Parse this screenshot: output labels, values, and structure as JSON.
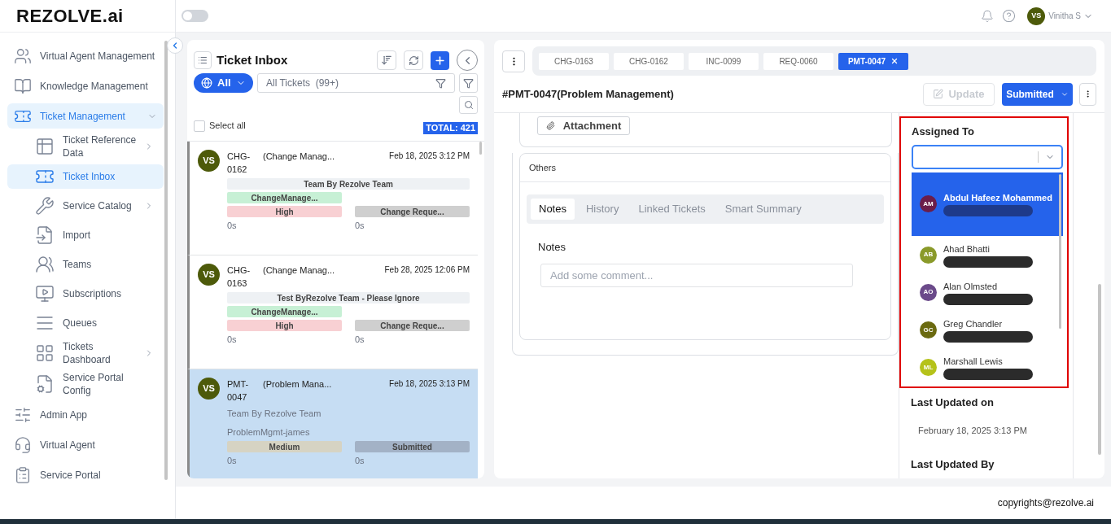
{
  "brand": {
    "name": "REZOLVE.ai"
  },
  "header": {
    "toggle": {
      "on": false
    },
    "user": {
      "initials": "VS",
      "name": "Vinitha S"
    }
  },
  "sidebar": {
    "items": [
      {
        "label": "Virtual Agent Management",
        "selected": false
      },
      {
        "label": "Knowledge Management",
        "selected": false
      },
      {
        "label": "Ticket Management",
        "selected": true,
        "expanded": true,
        "children": [
          {
            "label": "Ticket Reference Data",
            "selected": false,
            "submenu": true
          },
          {
            "label": "Ticket Inbox",
            "selected": true,
            "submenu": false
          },
          {
            "label": "Service Catalog",
            "selected": false,
            "submenu": true
          },
          {
            "label": "Import",
            "selected": false,
            "submenu": false
          },
          {
            "label": "Teams",
            "selected": false,
            "submenu": false
          },
          {
            "label": "Subscriptions",
            "selected": false,
            "submenu": false
          },
          {
            "label": "Queues",
            "selected": false,
            "submenu": false
          },
          {
            "label": "Tickets Dashboard",
            "selected": false,
            "submenu": true
          },
          {
            "label": "Service Portal Config",
            "selected": false,
            "submenu": false
          }
        ]
      },
      {
        "label": "Admin App",
        "selected": false
      },
      {
        "label": "Virtual Agent",
        "selected": false
      },
      {
        "label": "Service Portal",
        "selected": false
      }
    ]
  },
  "inbox": {
    "title": "Ticket Inbox",
    "scope": "All",
    "search": {
      "placeholder": "All Tickets  (99+)"
    },
    "select_all": {
      "label": "Select all",
      "checked": false
    },
    "total": "TOTAL: 421",
    "tickets": [
      {
        "initials": "VS",
        "id": "CHG-0162",
        "title": "(Change Manag...",
        "date": "Feb 18, 2025 3:12 PM",
        "team": "Team By Rezolve Team",
        "category": "ChangeManage...",
        "priority": {
          "label": "High",
          "color": "#f8d0d3"
        },
        "status": {
          "label": "Change Reque...",
          "color": "#cfcfcf"
        },
        "timer_1": "0s",
        "timer_2": "0s",
        "selected": false
      },
      {
        "initials": "VS",
        "id": "CHG-0163",
        "title": "(Change Manag...",
        "date": "Feb 28, 2025 12:06 PM",
        "team": "Test ByRezolve Team - Please Ignore",
        "category": "ChangeManage...",
        "priority": {
          "label": "High",
          "color": "#f8d0d3"
        },
        "status": {
          "label": "Change Reque...",
          "color": "#cfcfcf"
        },
        "timer_1": "0s",
        "timer_2": "0s",
        "selected": false
      },
      {
        "initials": "VS",
        "id": "PMT-0047",
        "title": "(Problem Mana...",
        "date": "Feb 18, 2025 3:13 PM",
        "team": "Team By Rezolve Team",
        "category": "ProblemMgmt-james",
        "priority": {
          "label": "Medium",
          "color": "#d6d3c3"
        },
        "status": {
          "label": "Submitted",
          "color": "#a3b2c6"
        },
        "timer_1": "0s",
        "timer_2": "0s",
        "selected": true
      }
    ]
  },
  "detail": {
    "tabs": [
      {
        "label": "CHG-0163",
        "selected": false
      },
      {
        "label": "CHG-0162",
        "selected": false
      },
      {
        "label": "INC-0099",
        "selected": false
      },
      {
        "label": "REQ-0060",
        "selected": false
      },
      {
        "label": "PMT-0047",
        "selected": true
      }
    ],
    "title": "#PMT-0047(Problem Management)",
    "update_button": {
      "label": "Update",
      "disabled": true
    },
    "status_button": "Submitted",
    "attachment_button": "Attachment",
    "others": {
      "title": "Others",
      "tabs": [
        {
          "label": "Notes",
          "selected": true
        },
        {
          "label": "History",
          "selected": false
        },
        {
          "label": "Linked Tickets",
          "selected": false
        },
        {
          "label": "Smart Summary",
          "selected": false
        }
      ],
      "notes_label": "Notes",
      "comment": {
        "placeholder": "Add some comment..."
      }
    },
    "assigned_to": {
      "label": "Assigned To",
      "options": [
        {
          "initials": "AM",
          "name": "Abdul Hafeez Mohammed",
          "color": "#6b1d4a",
          "selected": true
        },
        {
          "initials": "AB",
          "name": "Ahad Bhatti",
          "color": "#8a9a2a",
          "selected": false
        },
        {
          "initials": "AO",
          "name": "Alan Olmsted",
          "color": "#6b4a8a",
          "selected": false
        },
        {
          "initials": "GC",
          "name": "Greg Chandler",
          "color": "#6b6a10",
          "selected": false
        },
        {
          "initials": "ML",
          "name": "Marshall Lewis",
          "color": "#b5c21a",
          "selected": false
        }
      ]
    },
    "last_updated_on": {
      "label": "Last Updated on",
      "value": "February 18, 2025 3:13 PM"
    },
    "last_updated_by": {
      "label": "Last Updated By"
    }
  },
  "footer": {
    "text": "copyrights@rezolve.ai"
  }
}
